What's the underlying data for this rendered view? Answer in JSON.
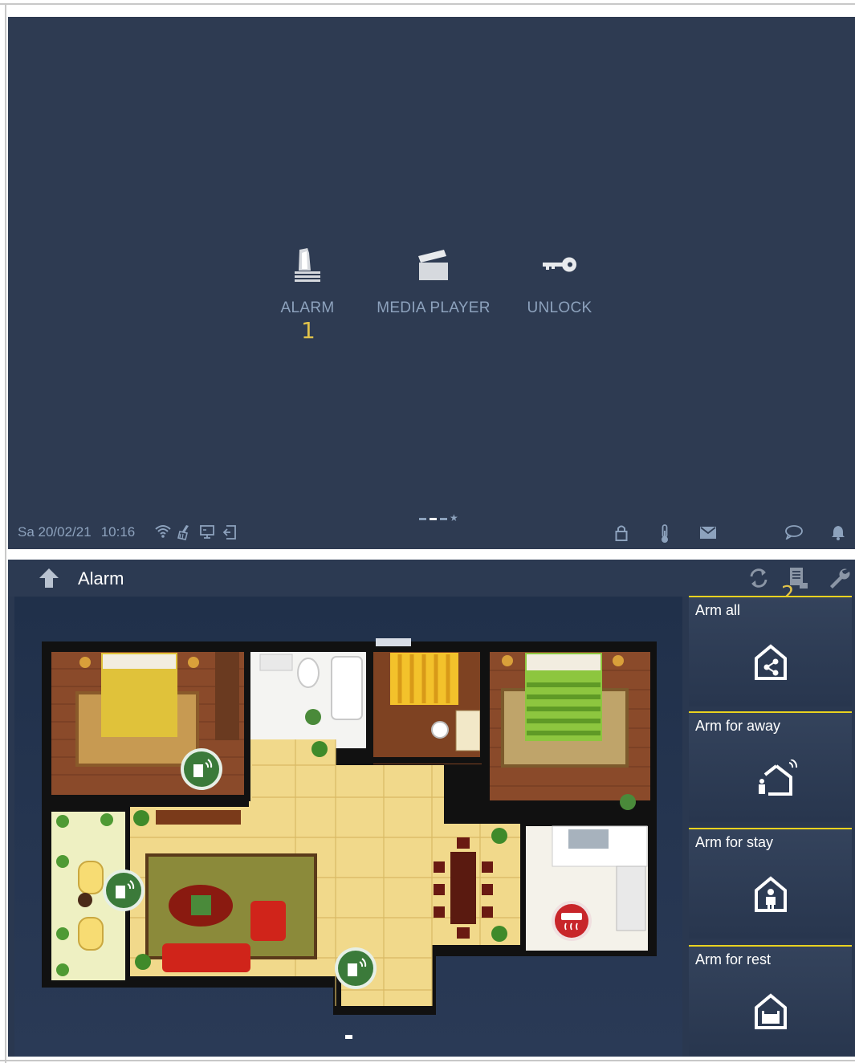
{
  "home_screen": {
    "apps": [
      {
        "label": "ALARM",
        "icon": "alarm-siren-icon"
      },
      {
        "label": "MEDIA PLAYER",
        "icon": "clapperboard-icon"
      },
      {
        "label": "UNLOCK",
        "icon": "key-icon"
      }
    ],
    "callout_1": "1",
    "status_bar": {
      "date": "Sa 20/02/21",
      "time": "10:16",
      "left_icons": [
        "wifi-icon",
        "broom-icon",
        "monitor-icon",
        "exit-icon"
      ],
      "right_icons": [
        "lock-icon",
        "thermometer-icon",
        "mail-icon",
        "chat-icon",
        "bell-icon"
      ]
    }
  },
  "alarm_screen": {
    "title": "Alarm",
    "header_icons": [
      "back-arrow-icon",
      "refresh-icon",
      "log-icon",
      "wrench-icon"
    ],
    "callout_2": "2",
    "modes": [
      {
        "label": "Arm all",
        "icon": "house-share-icon"
      },
      {
        "label": "Arm for away",
        "icon": "person-leaving-house-icon"
      },
      {
        "label": "Arm for stay",
        "icon": "person-in-house-icon"
      },
      {
        "label": "Arm for rest",
        "icon": "bed-in-house-icon"
      }
    ],
    "floorplan_sensors": [
      "door-sensor-icon",
      "door-sensor-icon",
      "door-sensor-icon",
      "heater-sensor-icon"
    ]
  },
  "colors": {
    "screen_bg": "#2e3b52",
    "label_blue": "#8da2bd",
    "callout_yellow": "#e0c24a",
    "accent_yellow": "#e9d21f"
  }
}
